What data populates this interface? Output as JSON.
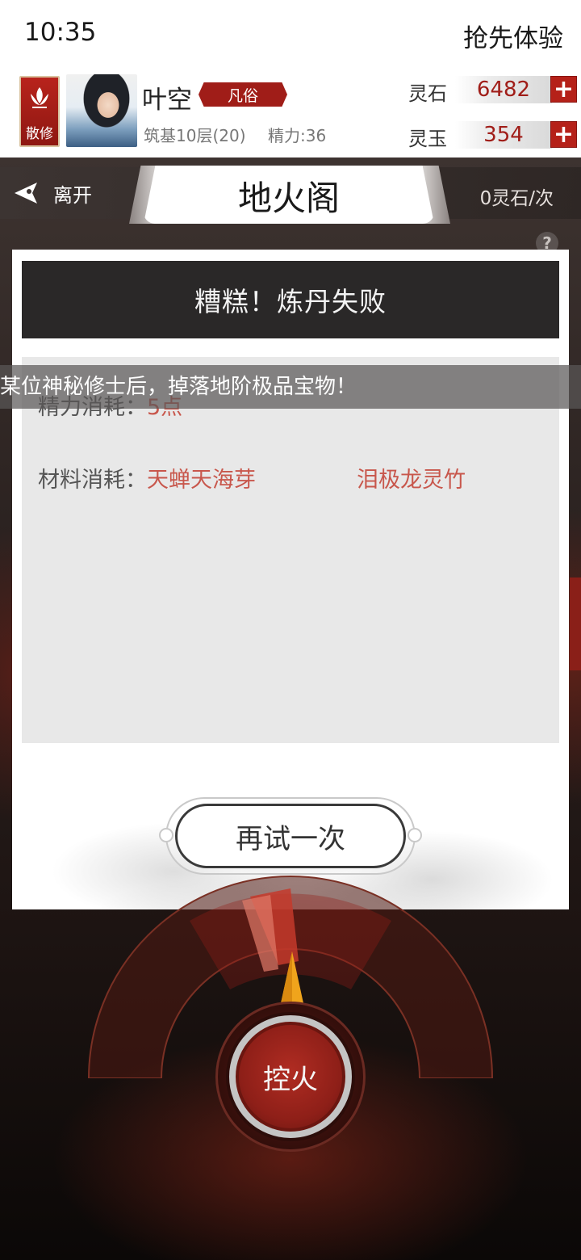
{
  "status_bar": {
    "time": "10:35",
    "right_text": "抢先体验"
  },
  "player": {
    "sect_label": "散修",
    "sect_icon": "lotus-icon",
    "name": "叶空",
    "realm_tag": "凡俗",
    "level_text": "筑基10层(20)",
    "energy_text": "精力:36"
  },
  "currency": {
    "spirit_stone": {
      "label": "灵石",
      "value": "6482",
      "add_icon": "plus-icon"
    },
    "spirit_jade": {
      "label": "灵玉",
      "value": "354",
      "add_icon": "plus-icon"
    }
  },
  "nav": {
    "leave_label": "离开",
    "leave_icon": "back-arrow-icon",
    "title": "地火阁",
    "cost": "0灵石/次",
    "help_icon": "?"
  },
  "result": {
    "banner": "糟糕！炼丹失败",
    "energy_label": "精力消耗：",
    "energy_value": "5点",
    "material_label": "材料消耗：",
    "material_1": "天蝉天海芽",
    "material_2": "泪极龙灵竹",
    "retry_label": "再试一次"
  },
  "notice": {
    "text": "某位神秘修士后，掉落地阶极品宝物！"
  },
  "furnace": {
    "control_label": "控火"
  },
  "colors": {
    "accent_red": "#a01d18",
    "value_red": "#c8574c",
    "banner_dark": "#2a2828"
  }
}
